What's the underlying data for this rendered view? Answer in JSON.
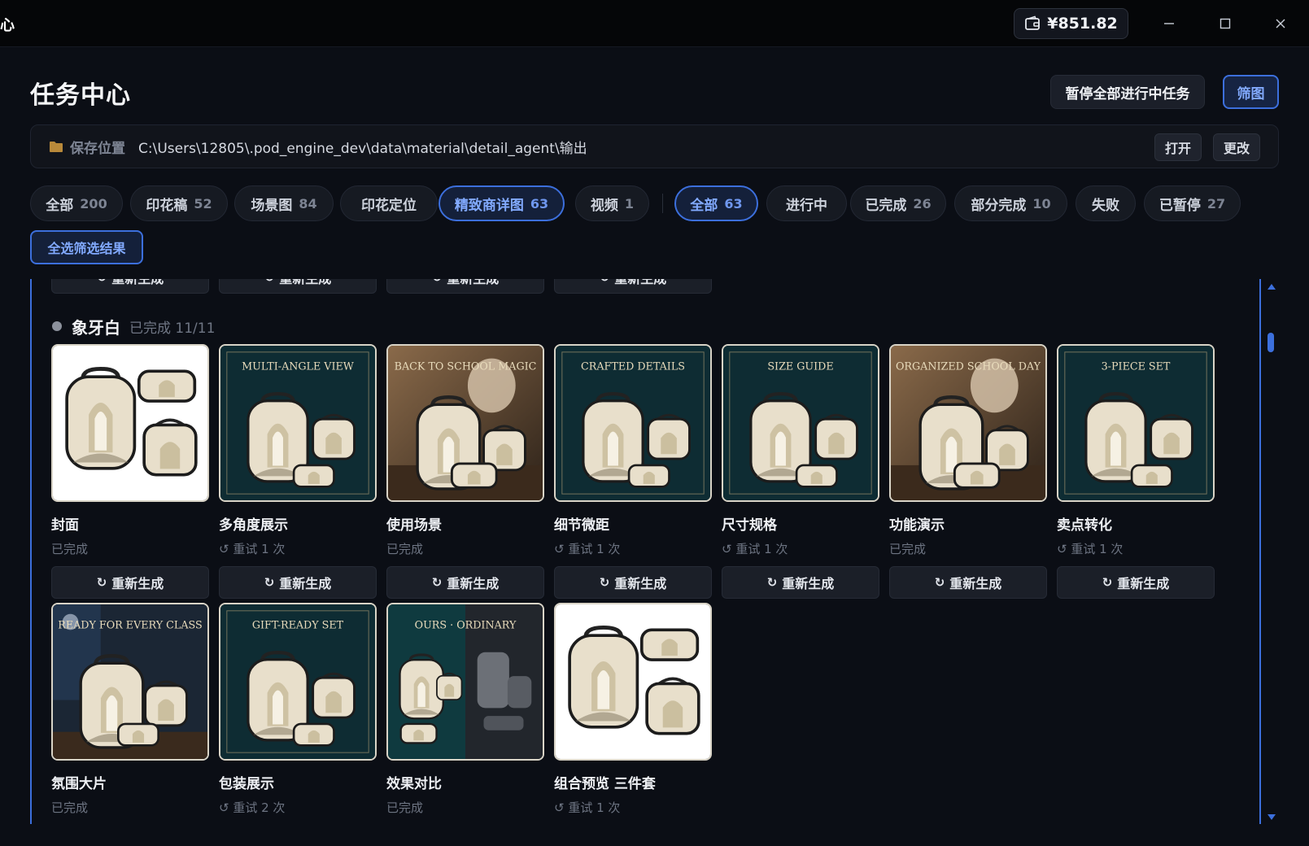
{
  "titlebar": {
    "app_fragment": "心",
    "balance": "¥851.82"
  },
  "header": {
    "title": "任务中心",
    "pause_all_label": "暂停全部进行中任务",
    "filter_label": "筛图"
  },
  "save_path": {
    "label": "保存位置",
    "value": "C:\\Users\\12805\\.pod_engine_dev\\data\\material\\detail_agent\\输出",
    "open_label": "打开",
    "change_label": "更改"
  },
  "type_chips": [
    {
      "label": "全部",
      "count": "200",
      "active": false
    },
    {
      "label": "印花稿",
      "count": "52",
      "active": false
    },
    {
      "label": "场景图",
      "count": "84",
      "active": false
    },
    {
      "label": "印花定位",
      "count": "",
      "active": false
    },
    {
      "label": "精致商详图",
      "count": "63",
      "active": true
    },
    {
      "label": "视频",
      "count": "1",
      "active": false
    }
  ],
  "status_chips": [
    {
      "label": "全部",
      "count": "63",
      "active": true
    },
    {
      "label": "进行中",
      "count": "",
      "active": false
    },
    {
      "label": "已完成",
      "count": "26",
      "active": false
    },
    {
      "label": "部分完成",
      "count": "10",
      "active": false
    },
    {
      "label": "失败",
      "count": "",
      "active": false
    },
    {
      "label": "已暂停",
      "count": "27",
      "active": false
    }
  ],
  "select_all_label": "全选筛选结果",
  "regen_label": "重新生成",
  "group": {
    "name": "象牙白",
    "status": "已完成 11/11"
  },
  "cards": [
    {
      "title": "封面",
      "status": "已完成",
      "retry": false,
      "heading": "",
      "style": "white"
    },
    {
      "title": "多角度展示",
      "status": "重试 1 次",
      "retry": true,
      "heading": "MULTI-ANGLE VIEW",
      "style": "dark"
    },
    {
      "title": "使用场景",
      "status": "已完成",
      "retry": false,
      "heading": "BACK TO SCHOOL MAGIC",
      "style": "warm"
    },
    {
      "title": "细节微距",
      "status": "重试 1 次",
      "retry": true,
      "heading": "CRAFTED DETAILS",
      "style": "dark"
    },
    {
      "title": "尺寸规格",
      "status": "重试 1 次",
      "retry": true,
      "heading": "SIZE GUIDE",
      "style": "dark"
    },
    {
      "title": "功能演示",
      "status": "已完成",
      "retry": false,
      "heading": "ORGANIZED SCHOOL DAY",
      "style": "warm"
    },
    {
      "title": "卖点转化",
      "status": "重试 1 次",
      "retry": true,
      "heading": "3-PIECE SET",
      "style": "dark"
    },
    {
      "title": "氛围大片",
      "status": "已完成",
      "retry": false,
      "heading": "READY FOR EVERY CLASS",
      "style": "night"
    },
    {
      "title": "包装展示",
      "status": "重试 2 次",
      "retry": true,
      "heading": "GIFT-READY SET",
      "style": "dark"
    },
    {
      "title": "效果对比",
      "status": "已完成",
      "retry": false,
      "heading": "OURS · ORDINARY",
      "style": "compare"
    },
    {
      "title": "组合预览 三件套",
      "status": "重试 1 次",
      "retry": true,
      "heading": "",
      "style": "white"
    }
  ],
  "colors": {
    "accent": "#3c6fdc",
    "accent_text": "#82aaff",
    "background": "#0b0e15",
    "ivory": "#e8dfcb"
  }
}
